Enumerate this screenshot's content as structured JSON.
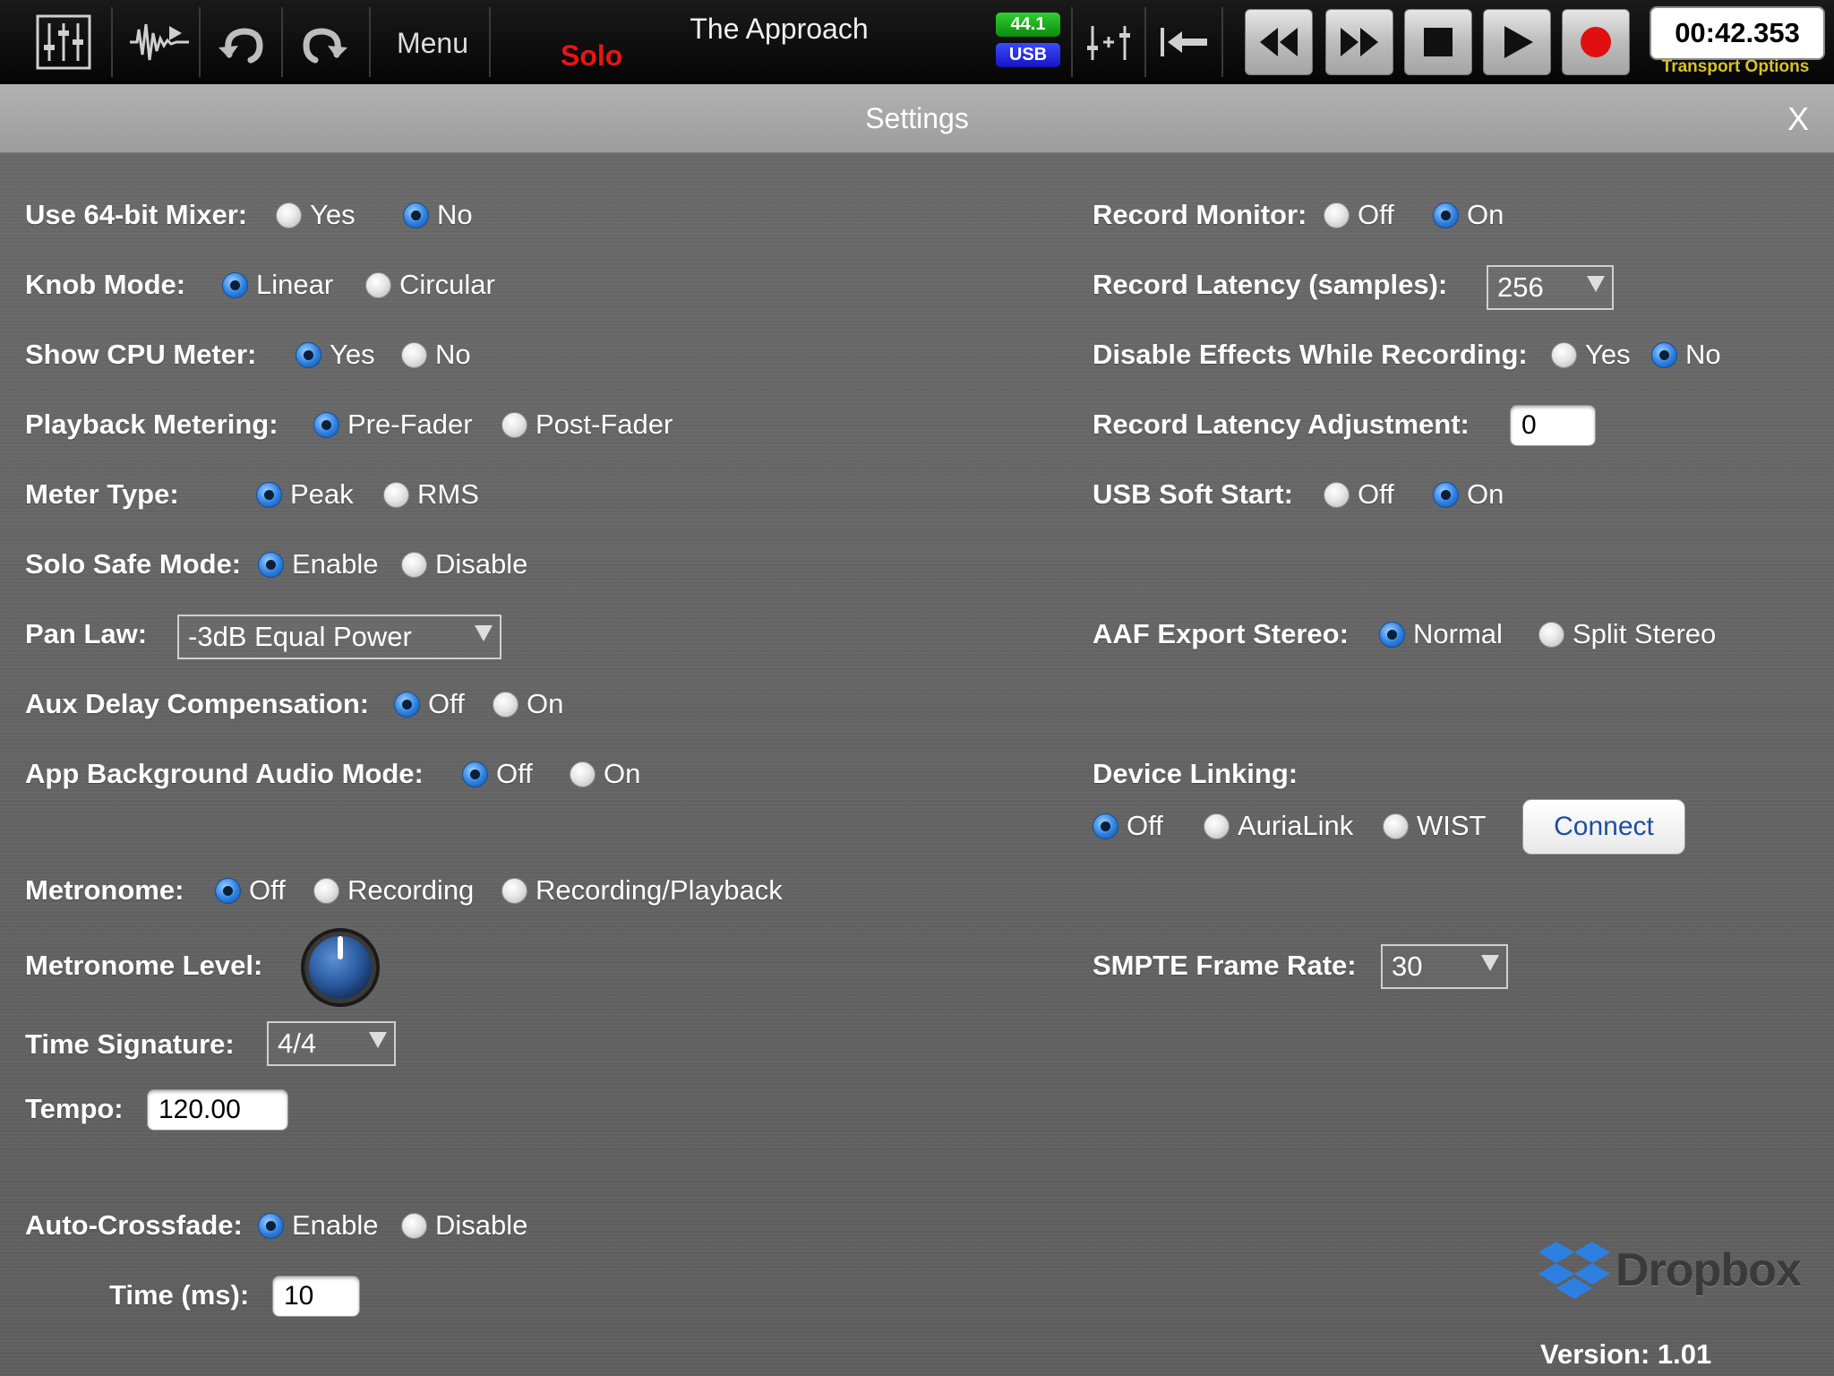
{
  "topbar": {
    "menu_label": "Menu",
    "solo_label": "Solo",
    "song_title": "The Approach",
    "sample_rate": "44.1",
    "interface": "USB",
    "time": "00:42.353",
    "transport_options": "Transport Options",
    "colors": {
      "solo": "#e81414",
      "rate_badge": "#1aa51a",
      "usb_badge": "#2020e0",
      "record": "#e01010"
    }
  },
  "settings": {
    "title": "Settings",
    "close": "X",
    "left": {
      "use_64bit_mixer": {
        "label": "Use 64-bit Mixer:",
        "options": [
          "Yes",
          "No"
        ],
        "selected": "No"
      },
      "knob_mode": {
        "label": "Knob Mode:",
        "options": [
          "Linear",
          "Circular"
        ],
        "selected": "Linear"
      },
      "show_cpu_meter": {
        "label": "Show CPU Meter:",
        "options": [
          "Yes",
          "No"
        ],
        "selected": "Yes"
      },
      "playback_metering": {
        "label": "Playback Metering:",
        "options": [
          "Pre-Fader",
          "Post-Fader"
        ],
        "selected": "Pre-Fader"
      },
      "meter_type": {
        "label": "Meter Type:",
        "options": [
          "Peak",
          "RMS"
        ],
        "selected": "Peak"
      },
      "solo_safe_mode": {
        "label": "Solo Safe Mode:",
        "options": [
          "Enable",
          "Disable"
        ],
        "selected": "Enable"
      },
      "pan_law": {
        "label": "Pan Law:",
        "value": "-3dB Equal Power"
      },
      "aux_delay_compensation": {
        "label": "Aux Delay Compensation:",
        "options": [
          "Off",
          "On"
        ],
        "selected": "Off"
      },
      "app_background_audio": {
        "label": "App Background Audio Mode:",
        "options": [
          "Off",
          "On"
        ],
        "selected": "Off"
      },
      "metronome": {
        "label": "Metronome:",
        "options": [
          "Off",
          "Recording",
          "Recording/Playback"
        ],
        "selected": "Off"
      },
      "metronome_level": {
        "label": "Metronome Level:"
      },
      "time_signature": {
        "label": "Time Signature:",
        "value": "4/4"
      },
      "tempo": {
        "label": "Tempo:",
        "value": "120.00"
      },
      "auto_crossfade": {
        "label": "Auto-Crossfade:",
        "options": [
          "Enable",
          "Disable"
        ],
        "selected": "Enable"
      },
      "crossfade_time": {
        "label": "Time (ms):",
        "value": "10"
      }
    },
    "right": {
      "record_monitor": {
        "label": "Record Monitor:",
        "options": [
          "Off",
          "On"
        ],
        "selected": "On"
      },
      "record_latency": {
        "label": "Record Latency (samples):",
        "value": "256"
      },
      "disable_effects_recording": {
        "label": "Disable Effects While Recording:",
        "options": [
          "Yes",
          "No"
        ],
        "selected": "No"
      },
      "record_latency_adjustment": {
        "label": "Record Latency Adjustment:",
        "value": "0"
      },
      "usb_soft_start": {
        "label": "USB Soft Start:",
        "options": [
          "Off",
          "On"
        ],
        "selected": "On"
      },
      "aaf_export_stereo": {
        "label": "AAF Export Stereo:",
        "options": [
          "Normal",
          "Split Stereo"
        ],
        "selected": "Normal"
      },
      "device_linking": {
        "label": "Device Linking:",
        "options": [
          "Off",
          "AuriaLink",
          "WIST"
        ],
        "selected": "Off",
        "connect_label": "Connect"
      },
      "smpte_frame_rate": {
        "label": "SMPTE Frame Rate:",
        "value": "30"
      }
    },
    "dropbox_label": "Dropbox",
    "version": "Version: 1.01"
  }
}
